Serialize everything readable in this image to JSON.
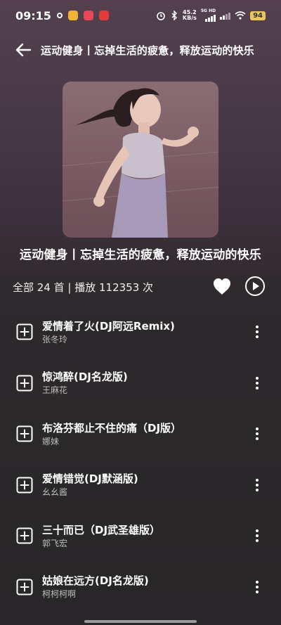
{
  "status_bar": {
    "time": "09:15",
    "net_speed": "45.2",
    "net_unit": "KB/s",
    "network_type": "5G HD",
    "battery": "94"
  },
  "header": {
    "back_icon": "arrow-left-icon",
    "title": "运动健身丨忘掉生活的疲惫，释放运动的快乐"
  },
  "playlist": {
    "title": "运动健身丨忘掉生活的疲惫，释放运动的快乐",
    "meta": "全部 24 首 | 播放 112353 次",
    "favorite_icon": "heart-icon",
    "play_icon": "play-circle-icon"
  },
  "songs": [
    {
      "title": "爱情着了火(DJ阿远Remix)",
      "artist": "张冬玲"
    },
    {
      "title": "惊鸿醉(DJ名龙版)",
      "artist": "王麻花"
    },
    {
      "title": "布洛芬都止不住的痛（DJ版）",
      "artist": "娜妹"
    },
    {
      "title": "爱情错觉(DJ默涵版)",
      "artist": "幺幺酱"
    },
    {
      "title": "三十而已（DJ武圣雄版）",
      "artist": "郭飞宏"
    },
    {
      "title": "姑娘在远方(DJ名龙版)",
      "artist": "柯柯柯啊"
    }
  ],
  "colors": {
    "background_top": "#54404f",
    "background_bottom": "#282628",
    "battery": "#e8c75c"
  }
}
